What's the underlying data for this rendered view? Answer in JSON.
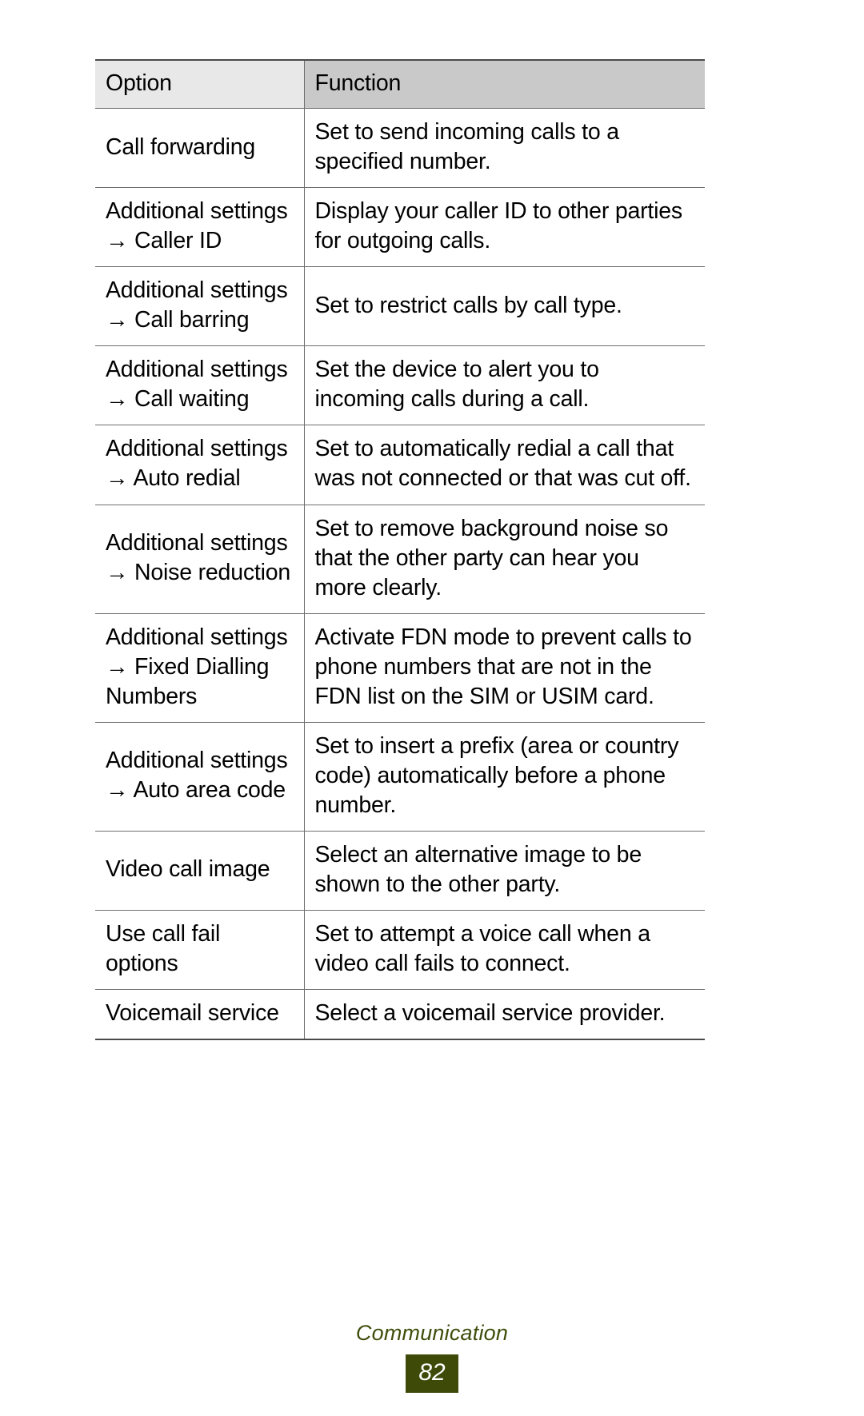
{
  "document": {
    "table": {
      "name": "call-settings-options-table",
      "headers": {
        "option": "Option",
        "function": "Function"
      },
      "header_colors": {
        "option_cell": "#e8e8e8",
        "function_cell": "#c9c9c9"
      },
      "rows": [
        {
          "option": "Call forwarding",
          "function": "Set to send incoming calls to a specified number."
        },
        {
          "option": "Additional settings → Caller ID",
          "function": "Display your caller ID to other parties for outgoing calls."
        },
        {
          "option": "Additional settings → Call barring",
          "function": "Set to restrict calls by call type."
        },
        {
          "option": "Additional settings → Call waiting",
          "function": "Set the device to alert you to incoming calls during a call."
        },
        {
          "option": "Additional settings → Auto redial",
          "function": "Set to automatically redial a call that was not connected or that was cut off."
        },
        {
          "option": "Additional settings → Noise reduction",
          "function": "Set to remove background noise so that the other party can hear you more clearly."
        },
        {
          "option": "Additional settings → Fixed Dialling Numbers",
          "function": "Activate FDN mode to prevent calls to phone numbers that are not in the FDN list on the SIM or USIM card."
        },
        {
          "option": "Additional settings → Auto area code",
          "function": "Set to insert a prefix (area or country code) automatically before a phone number."
        },
        {
          "option": "Video call image",
          "function": "Select an alternative image to be shown to the other party."
        },
        {
          "option": "Use call fail options",
          "function": "Set to attempt a voice call when a video call fails to connect."
        },
        {
          "option": "Voicemail service",
          "function": "Select a voicemail service provider."
        }
      ]
    },
    "footer": {
      "section": "Communication",
      "page_number": "82",
      "badge_color": "#3d4a08",
      "section_color": "#3f4d0a"
    }
  }
}
